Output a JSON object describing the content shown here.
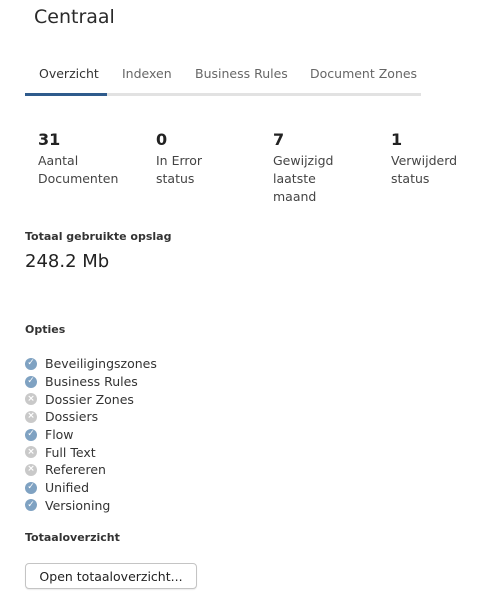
{
  "page": {
    "title": "Centraal"
  },
  "tabs": [
    {
      "label": "Overzicht",
      "active": true
    },
    {
      "label": "Indexen",
      "active": false
    },
    {
      "label": "Business Rules",
      "active": false
    },
    {
      "label": "Document Zones",
      "active": false
    }
  ],
  "stats": [
    {
      "value": "31",
      "label_lines": [
        "Aantal",
        "Documenten"
      ]
    },
    {
      "value": "0",
      "label_lines": [
        "In Error",
        "status"
      ]
    },
    {
      "value": "7",
      "label_lines": [
        "Gewijzigd",
        "laatste",
        "maand"
      ]
    },
    {
      "value": "1",
      "label_lines": [
        "Verwijderd",
        "status"
      ]
    }
  ],
  "storage": {
    "label": "Totaal gebruikte opslag",
    "value": "248.2 Mb"
  },
  "options": {
    "heading": "Opties",
    "items": [
      {
        "label": "Beveiligingszones",
        "enabled": true
      },
      {
        "label": "Business Rules",
        "enabled": true
      },
      {
        "label": "Dossier Zones",
        "enabled": false
      },
      {
        "label": "Dossiers",
        "enabled": false
      },
      {
        "label": "Flow",
        "enabled": true
      },
      {
        "label": "Full Text",
        "enabled": false
      },
      {
        "label": "Refereren",
        "enabled": false
      },
      {
        "label": "Unified",
        "enabled": true
      },
      {
        "label": "Versioning",
        "enabled": true
      }
    ]
  },
  "overview": {
    "heading": "Totaaloverzicht",
    "button_label": "Open totaaloverzicht..."
  },
  "colors": {
    "accent": "#2f5b8c",
    "enabled_icon": "#7fa2c2",
    "disabled_icon": "#c9c9c9"
  },
  "icons": {
    "enabled": "check-circle-icon",
    "disabled": "x-circle-icon"
  }
}
